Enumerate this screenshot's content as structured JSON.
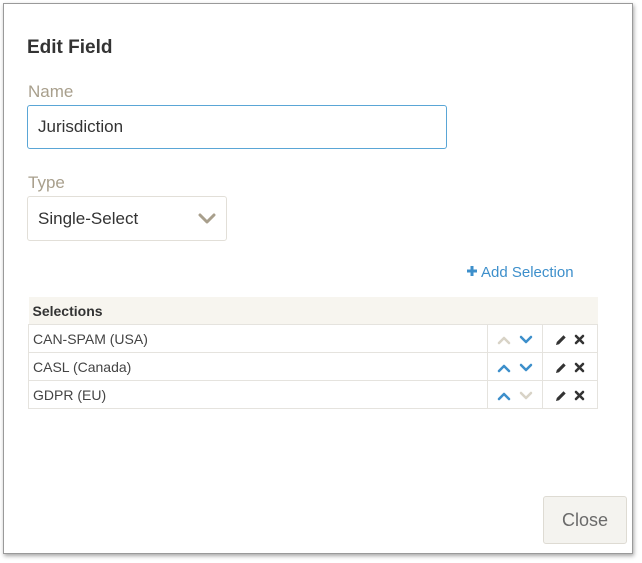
{
  "dialog": {
    "title": "Edit Field",
    "name_label": "Name",
    "name_value": "Jurisdiction",
    "type_label": "Type",
    "type_value": "Single-Select",
    "add_selection_label": "Add Selection",
    "close_label": "Close"
  },
  "table": {
    "header": "Selections",
    "rows": [
      {
        "label": "CAN-SPAM (USA)",
        "up_enabled": false,
        "down_enabled": true
      },
      {
        "label": "CASL (Canada)",
        "up_enabled": true,
        "down_enabled": true
      },
      {
        "label": "GDPR (EU)",
        "up_enabled": true,
        "down_enabled": false
      }
    ]
  },
  "colors": {
    "accent": "#3d8fcb",
    "arrow_enabled": "#3d8fcb",
    "arrow_disabled": "#d8d3c6",
    "label": "#a89f8c"
  },
  "icons": {
    "select_chevron": "chevron-down-icon",
    "add": "plus-icon",
    "move_up": "chevron-up-icon",
    "move_down": "chevron-down-icon",
    "edit": "pencil-icon",
    "delete": "close-icon"
  }
}
